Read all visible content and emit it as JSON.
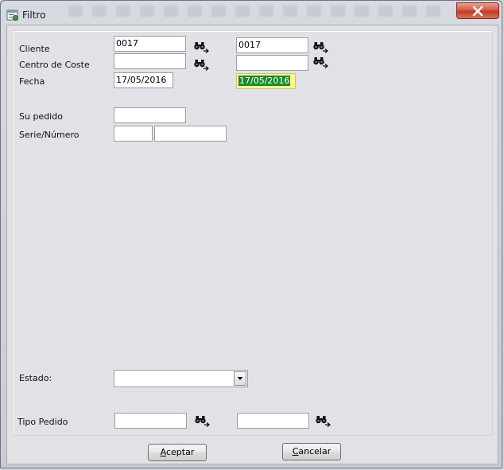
{
  "window": {
    "title": "Filtro"
  },
  "fields": {
    "cliente": {
      "label": "Cliente",
      "from": "0017",
      "to": "0017"
    },
    "centro_coste": {
      "label": "Centro de Coste",
      "from": "",
      "to": ""
    },
    "fecha": {
      "label": "Fecha",
      "from": "17/05/2016",
      "to": "17/05/2016"
    },
    "su_pedido": {
      "label": "Su pedido",
      "value": ""
    },
    "serie_numero": {
      "label": "Serie/Número",
      "serie": "",
      "numero": ""
    },
    "estado": {
      "label": "Estado:",
      "value": ""
    },
    "tipo_pedido": {
      "label": "Tipo Pedido",
      "from": "",
      "to": ""
    }
  },
  "buttons": {
    "aceptar": {
      "accel": "A",
      "rest": "ceptar"
    },
    "cancelar": {
      "accel": "C",
      "rest": "ancelar"
    }
  },
  "icons": {
    "lookup": "binoculars-search-icon",
    "close": "close-icon",
    "app": "filter-window-icon",
    "dropdown": "chevron-down-icon"
  }
}
